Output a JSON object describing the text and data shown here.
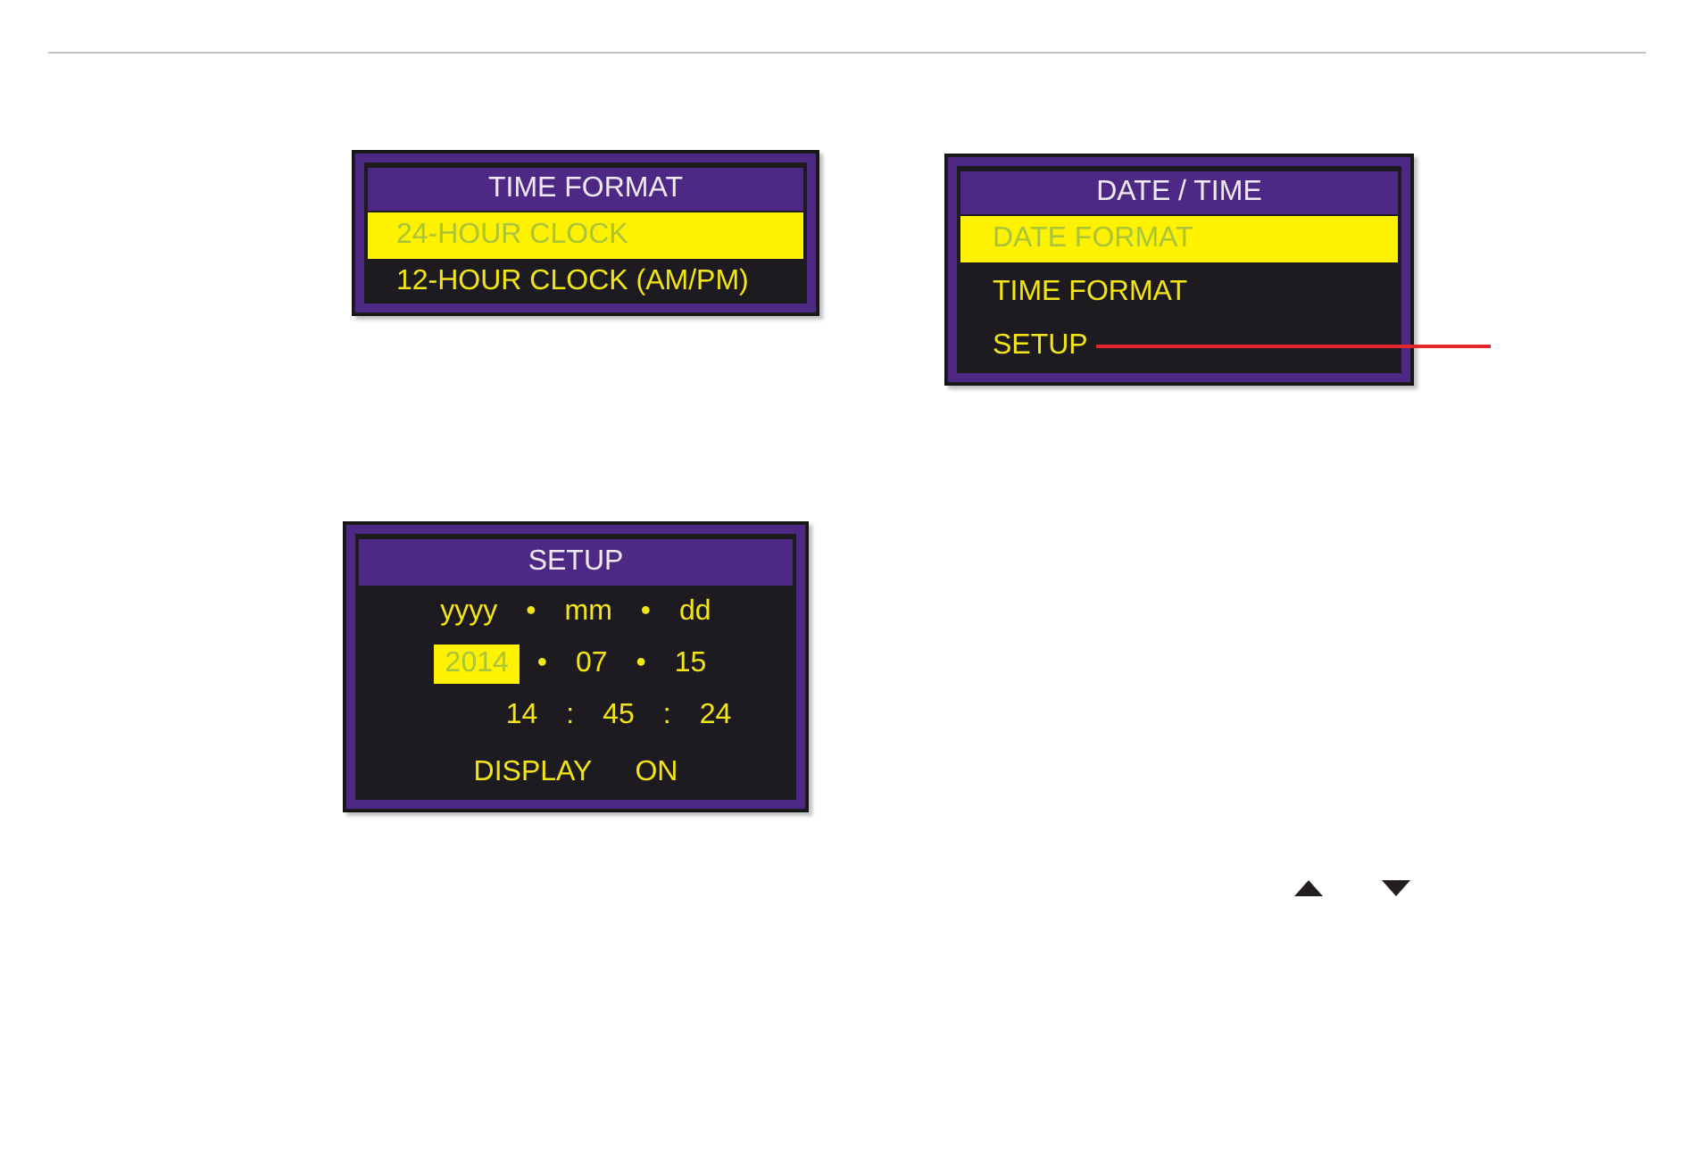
{
  "time_format_screen": {
    "title": "TIME FORMAT",
    "options": [
      {
        "label": "24-HOUR CLOCK",
        "selected": true
      },
      {
        "label": "12-HOUR CLOCK (AM/PM)",
        "selected": false
      }
    ]
  },
  "date_time_screen": {
    "title": "DATE / TIME",
    "options": [
      {
        "label": "DATE FORMAT",
        "selected": true,
        "callout": false
      },
      {
        "label": "TIME FORMAT",
        "selected": false,
        "callout": false
      },
      {
        "label": "SETUP",
        "selected": false,
        "callout": true
      }
    ]
  },
  "setup_screen": {
    "title": "SETUP",
    "rows": [
      {
        "kind": "format",
        "items": [
          {
            "kind": "value",
            "text": "yyyy",
            "selected": false
          },
          {
            "kind": "separator",
            "text": "•"
          },
          {
            "kind": "value",
            "text": "mm",
            "selected": false
          },
          {
            "kind": "separator",
            "text": "•"
          },
          {
            "kind": "value",
            "text": "dd",
            "selected": false
          }
        ]
      },
      {
        "kind": "date",
        "items": [
          {
            "kind": "value",
            "text": "2014",
            "selected": true
          },
          {
            "kind": "separator",
            "text": "•"
          },
          {
            "kind": "value",
            "text": "07",
            "selected": false
          },
          {
            "kind": "separator",
            "text": "•"
          },
          {
            "kind": "value",
            "text": "15",
            "selected": false
          }
        ]
      },
      {
        "kind": "time",
        "items": [
          {
            "kind": "value",
            "text": "14",
            "selected": false
          },
          {
            "kind": "separator",
            "text": ":"
          },
          {
            "kind": "value",
            "text": "45",
            "selected": false
          },
          {
            "kind": "separator",
            "text": ":"
          },
          {
            "kind": "value",
            "text": "24",
            "selected": false
          }
        ]
      },
      {
        "kind": "display",
        "items": [
          {
            "kind": "label",
            "text": "DISPLAY"
          },
          {
            "kind": "value",
            "text": "ON",
            "selected": false
          }
        ]
      }
    ]
  }
}
